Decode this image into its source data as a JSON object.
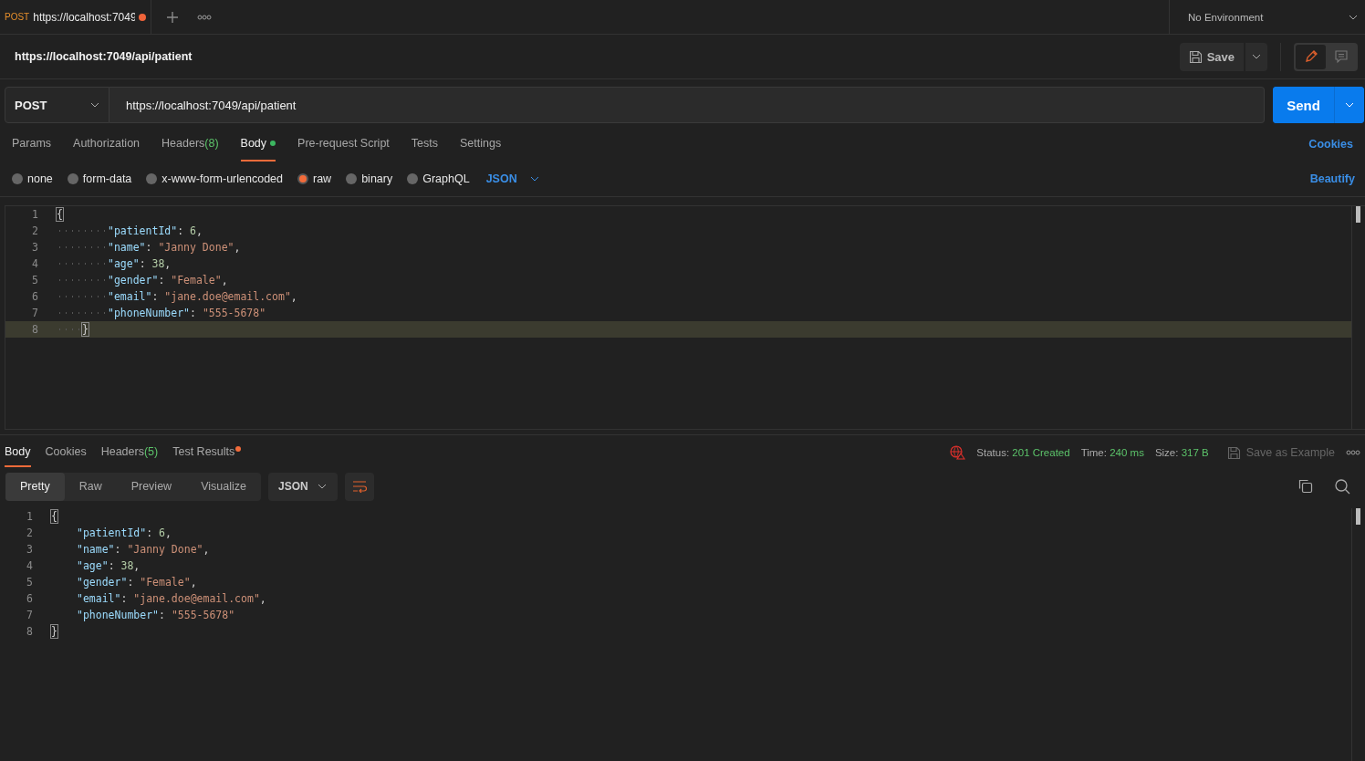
{
  "tab": {
    "method": "POST",
    "title": "https://localhost:7049",
    "unsaved": true
  },
  "environment": "No Environment",
  "request_title": "https://localhost:7049/api/patient",
  "save_label": "Save",
  "request": {
    "method": "POST",
    "url": "https://localhost:7049/api/patient",
    "send_label": "Send"
  },
  "request_tabs": [
    {
      "label": "Params",
      "dot": false,
      "selected": false
    },
    {
      "label": "Authorization",
      "dot": false,
      "selected": false
    },
    {
      "label": "Headers",
      "count": "(8)",
      "dot": false,
      "selected": false
    },
    {
      "label": "Body",
      "dot": true,
      "selected": true
    },
    {
      "label": "Pre-request Script",
      "dot": false,
      "selected": false
    },
    {
      "label": "Tests",
      "dot": false,
      "selected": false
    },
    {
      "label": "Settings",
      "dot": false,
      "selected": false
    }
  ],
  "cookies_link": "Cookies",
  "body_types": [
    {
      "label": "none",
      "selected": false
    },
    {
      "label": "form-data",
      "selected": false
    },
    {
      "label": "x-www-form-urlencoded",
      "selected": false
    },
    {
      "label": "raw",
      "selected": true
    },
    {
      "label": "binary",
      "selected": false
    },
    {
      "label": "GraphQL",
      "selected": false
    }
  ],
  "body_format": "JSON",
  "beautify_link": "Beautify",
  "request_body": [
    {
      "number": "1",
      "current": false,
      "tokens": [
        {
          "kind": "brace",
          "text": "{"
        }
      ]
    },
    {
      "number": "2",
      "current": false,
      "tokens": [
        {
          "kind": "indent"
        },
        {
          "kind": "key",
          "text": "\"patientId\""
        },
        {
          "kind": "punct",
          "text": ": "
        },
        {
          "kind": "number",
          "text": "6"
        },
        {
          "kind": "punct",
          "text": ","
        }
      ]
    },
    {
      "number": "3",
      "current": false,
      "tokens": [
        {
          "kind": "indent"
        },
        {
          "kind": "key",
          "text": "\"name\""
        },
        {
          "kind": "punct",
          "text": ": "
        },
        {
          "kind": "string",
          "text": "\"Janny Done\""
        },
        {
          "kind": "punct",
          "text": ","
        }
      ]
    },
    {
      "number": "4",
      "current": false,
      "tokens": [
        {
          "kind": "indent"
        },
        {
          "kind": "key",
          "text": "\"age\""
        },
        {
          "kind": "punct",
          "text": ": "
        },
        {
          "kind": "number",
          "text": "38"
        },
        {
          "kind": "punct",
          "text": ","
        }
      ]
    },
    {
      "number": "5",
      "current": false,
      "tokens": [
        {
          "kind": "indent"
        },
        {
          "kind": "key",
          "text": "\"gender\""
        },
        {
          "kind": "punct",
          "text": ": "
        },
        {
          "kind": "string",
          "text": "\"Female\""
        },
        {
          "kind": "punct",
          "text": ","
        }
      ]
    },
    {
      "number": "6",
      "current": false,
      "tokens": [
        {
          "kind": "indent"
        },
        {
          "kind": "key",
          "text": "\"email\""
        },
        {
          "kind": "punct",
          "text": ": "
        },
        {
          "kind": "string",
          "text": "\"jane.doe@email.com\""
        },
        {
          "kind": "punct",
          "text": ","
        }
      ]
    },
    {
      "number": "7",
      "current": false,
      "tokens": [
        {
          "kind": "indent"
        },
        {
          "kind": "key",
          "text": "\"phoneNumber\""
        },
        {
          "kind": "punct",
          "text": ": "
        },
        {
          "kind": "string",
          "text": "\"555-5678\""
        }
      ]
    },
    {
      "number": "8",
      "current": true,
      "tokens": [
        {
          "kind": "halfindent"
        },
        {
          "kind": "brace",
          "text": "}"
        }
      ]
    }
  ],
  "response_tabs": [
    {
      "label": "Body",
      "dot": false,
      "selected": true
    },
    {
      "label": "Cookies",
      "dot": false,
      "selected": false
    },
    {
      "label": "Headers",
      "count": "(5)",
      "dot": false,
      "selected": false
    },
    {
      "label": "Test Results",
      "dot": true,
      "selected": false
    }
  ],
  "response_meta": [
    {
      "label": "Status:",
      "value": "201 Created"
    },
    {
      "label": "Time:",
      "value": "240 ms"
    },
    {
      "label": "Size:",
      "value": "317 B"
    }
  ],
  "save_example": "Save as Example",
  "view_modes": [
    {
      "label": "Pretty",
      "selected": true
    },
    {
      "label": "Raw",
      "selected": false
    },
    {
      "label": "Preview",
      "selected": false
    },
    {
      "label": "Visualize",
      "selected": false
    }
  ],
  "response_format": "JSON",
  "response_body": [
    {
      "number": "1",
      "tokens": [
        {
          "kind": "brace",
          "text": "{"
        }
      ]
    },
    {
      "number": "2",
      "tokens": [
        {
          "kind": "indent"
        },
        {
          "kind": "key",
          "text": "\"patientId\""
        },
        {
          "kind": "punct",
          "text": ": "
        },
        {
          "kind": "number",
          "text": "6"
        },
        {
          "kind": "punct",
          "text": ","
        }
      ]
    },
    {
      "number": "3",
      "tokens": [
        {
          "kind": "indent"
        },
        {
          "kind": "key",
          "text": "\"name\""
        },
        {
          "kind": "punct",
          "text": ": "
        },
        {
          "kind": "string",
          "text": "\"Janny Done\""
        },
        {
          "kind": "punct",
          "text": ","
        }
      ]
    },
    {
      "number": "4",
      "tokens": [
        {
          "kind": "indent"
        },
        {
          "kind": "key",
          "text": "\"age\""
        },
        {
          "kind": "punct",
          "text": ": "
        },
        {
          "kind": "number",
          "text": "38"
        },
        {
          "kind": "punct",
          "text": ","
        }
      ]
    },
    {
      "number": "5",
      "tokens": [
        {
          "kind": "indent"
        },
        {
          "kind": "key",
          "text": "\"gender\""
        },
        {
          "kind": "punct",
          "text": ": "
        },
        {
          "kind": "string",
          "text": "\"Female\""
        },
        {
          "kind": "punct",
          "text": ","
        }
      ]
    },
    {
      "number": "6",
      "tokens": [
        {
          "kind": "indent"
        },
        {
          "kind": "key",
          "text": "\"email\""
        },
        {
          "kind": "punct",
          "text": ": "
        },
        {
          "kind": "string",
          "text": "\"jane.doe@email.com\""
        },
        {
          "kind": "punct",
          "text": ","
        }
      ]
    },
    {
      "number": "7",
      "tokens": [
        {
          "kind": "indent"
        },
        {
          "kind": "key",
          "text": "\"phoneNumber\""
        },
        {
          "kind": "punct",
          "text": ": "
        },
        {
          "kind": "string",
          "text": "\"555-5678\""
        }
      ]
    },
    {
      "number": "8",
      "tokens": [
        {
          "kind": "brace",
          "text": "}"
        }
      ]
    }
  ]
}
